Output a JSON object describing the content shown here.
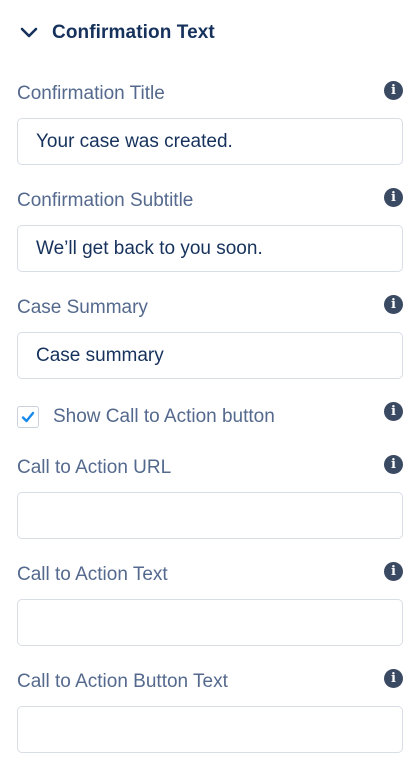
{
  "section": {
    "title": "Confirmation Text"
  },
  "fields": {
    "confirmation_title": {
      "label": "Confirmation Title",
      "value": "Your case was created."
    },
    "confirmation_subtitle": {
      "label": "Confirmation Subtitle",
      "value": "We’ll get back to you soon."
    },
    "case_summary": {
      "label": "Case Summary",
      "value": "Case summary"
    },
    "cta_url": {
      "label": "Call to Action URL",
      "value": ""
    },
    "cta_text": {
      "label": "Call to Action Text",
      "value": ""
    },
    "cta_button_text": {
      "label": "Call to Action Button Text",
      "value": ""
    }
  },
  "checkbox": {
    "label": "Show Call to Action button",
    "checked": true
  },
  "icons": {
    "chevron": "chevron-down-icon",
    "info": "info-icon",
    "check": "check-icon"
  },
  "colors": {
    "heading": "#16325c",
    "label": "#54698d",
    "info_icon": "#3b4a63",
    "checkmark": "#1589ee",
    "input_border": "#d8dde6"
  }
}
